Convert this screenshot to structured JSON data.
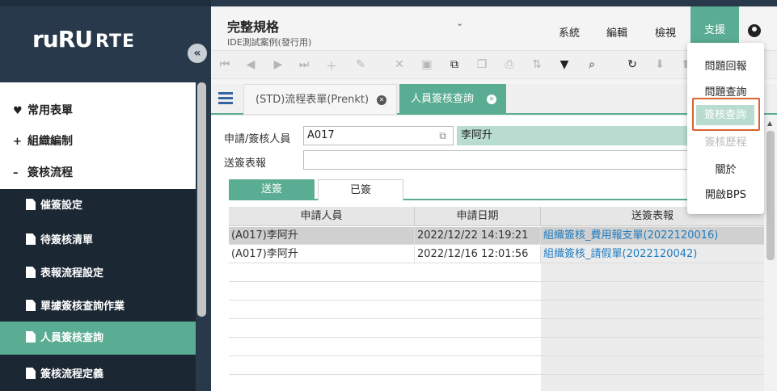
{
  "sidebar": {
    "logo_text": "ruRU",
    "logo_suffix": "RTE",
    "collapse_icon": "«",
    "groups": [
      {
        "icon": "heart-icon",
        "glyph": "♥",
        "label": "常用表單"
      },
      {
        "icon": "plus-icon",
        "glyph": "+",
        "label": "組織編制"
      },
      {
        "icon": "minus-icon",
        "glyph": "–",
        "label": "簽核流程"
      }
    ],
    "items": [
      {
        "label": "催簽設定",
        "active": false
      },
      {
        "label": "待簽核清單",
        "active": false
      },
      {
        "label": "表報流程設定",
        "active": false
      },
      {
        "label": "單據簽核查詢作業",
        "active": false
      },
      {
        "label": "人員簽核查詢",
        "active": true
      },
      {
        "label": "簽核流程定義",
        "active": false
      }
    ]
  },
  "header": {
    "title": "完整規格",
    "subtitle": "IDE測試案例(發行用)",
    "chevron": "⌄",
    "menus": [
      "系統",
      "編輯",
      "檢視",
      "支援"
    ]
  },
  "tabs": [
    {
      "label": "(STD)流程表單(Prenkt)",
      "active": false
    },
    {
      "label": "人員簽核查詢",
      "active": true
    }
  ],
  "form": {
    "applicant_label": "申請/簽核人員",
    "applicant_code": "A017",
    "applicant_name": "李阿升",
    "report_label": "送簽表報",
    "report_value": ""
  },
  "inner_tabs": [
    "送簽",
    "已簽"
  ],
  "grid": {
    "columns": [
      "申請人員",
      "申請日期",
      "送簽表報"
    ],
    "rows": [
      {
        "applicant": "(A017)李阿升",
        "date": "2022/12/22 14:19:21",
        "report": "組織簽核_費用報支單(2022120016)"
      },
      {
        "applicant": "(A017)李阿升",
        "date": "2022/12/16 12:01:56",
        "report": "組織簽核_請假單(2022120042)"
      }
    ]
  },
  "dropdown": {
    "items": [
      {
        "label": "問題回報",
        "state": "normal"
      },
      {
        "label": "問題查詢",
        "state": "normal"
      },
      {
        "label": "簽核查詢",
        "state": "active"
      },
      {
        "label": "簽核歷程",
        "state": "disabled"
      },
      {
        "label": "關於",
        "state": "normal"
      },
      {
        "label": "開啟BPS",
        "state": "normal"
      }
    ]
  },
  "colors": {
    "accent": "#5aac92",
    "sidebar": "#27394a",
    "highlight_border": "#d9642e",
    "link": "#1f7cc0"
  }
}
